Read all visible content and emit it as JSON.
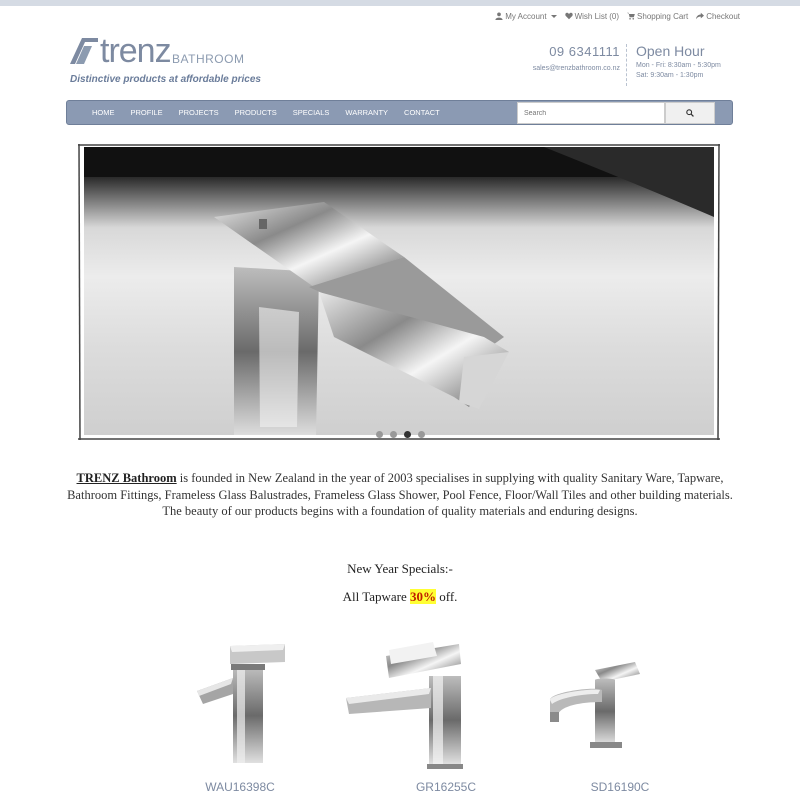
{
  "topbar": {
    "account": "My Account",
    "wishlist": "Wish List (0)",
    "cart": "Shopping Cart",
    "checkout": "Checkout"
  },
  "logo": {
    "word": "trenz",
    "sub": "BATHROOM",
    "tagline": "Distinctive products at affordable prices"
  },
  "contact": {
    "phone": "09 6341111",
    "email": "sales@trenzbathroom.co.nz"
  },
  "hours": {
    "title": "Open Hour",
    "weekday": "Mon - Fri: 8:30am - 5:30pm",
    "saturday": "Sat: 9:30am - 1:30pm"
  },
  "nav": {
    "items": [
      "HOME",
      "PROFILE",
      "PROJECTS",
      "PRODUCTS",
      "SPECIALS",
      "WARRANTY",
      "CONTACT"
    ],
    "search_placeholder": "Search"
  },
  "slider": {
    "slide_count": 4,
    "active_slide": 3
  },
  "intro": {
    "brand": "TRENZ Bathroom",
    "text": " is founded in New Zealand in the year of 2003 specialises in supplying with quality Sanitary Ware, Tapware, Bathroom Fittings, Frameless Glass Balustrades, Frameless Glass Shower, Pool Fence, Floor/Wall Tiles and other building materials. The beauty of our products begins with a foundation of quality materials and enduring designs."
  },
  "specials": {
    "title": "New Year Specials:-",
    "prefix": "All Tapware ",
    "discount": "30%",
    "suffix": " off."
  },
  "products": [
    {
      "name": "WAU16398C"
    },
    {
      "name": "GR16255C"
    },
    {
      "name": "SD16190C"
    }
  ],
  "colors": {
    "brand": "#7d8aa1",
    "nav_bg": "#8b9ab3",
    "highlight": "#ffff33"
  }
}
